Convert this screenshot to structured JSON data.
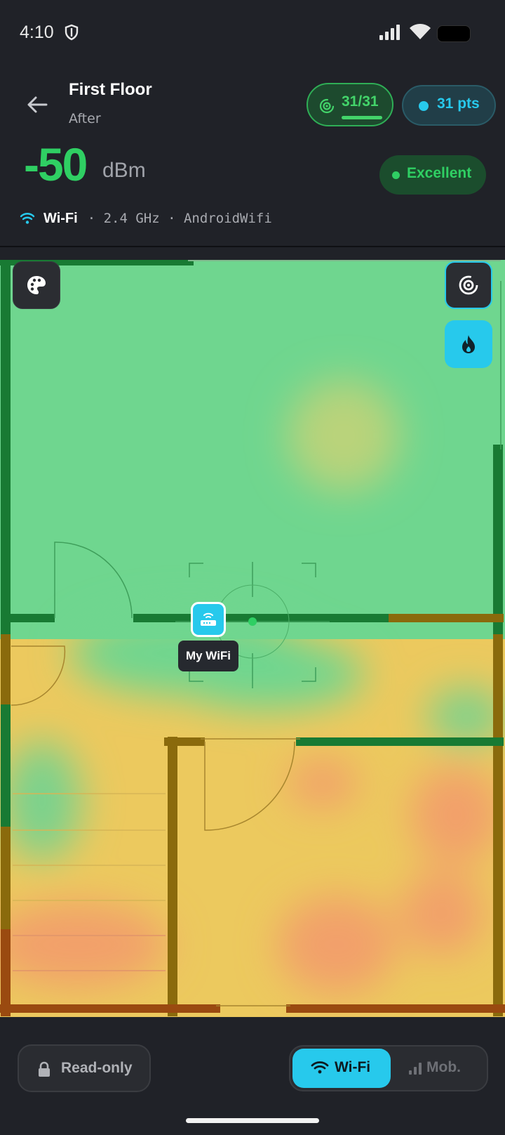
{
  "status_bar": {
    "time": "4:10"
  },
  "header": {
    "title": "First Floor",
    "subtitle": "After",
    "scan_count": "31/31",
    "scan_progress": 1.0,
    "points": "31 pts"
  },
  "signal": {
    "value": "-50",
    "unit": "dBm",
    "quality": "Excellent"
  },
  "network": {
    "type": "Wi-Fi",
    "meta": "· 2.4 GHz · AndroidWifi"
  },
  "map": {
    "router_label": "My WiFi"
  },
  "bottom": {
    "readonly_label": "Read-only",
    "wifi_label": "Wi-Fi",
    "mobile_label": "Mob."
  },
  "colors": {
    "accent": "#27c9ec",
    "excellent": "#2fcf63",
    "heat_good": "#6fd68f",
    "heat_fair": "#ecc95e",
    "heat_weak": "#f2a06a",
    "wall_good": "#187a33",
    "wall_fair": "#8a6a0c",
    "wall_weak": "#9a4a10"
  },
  "icons": [
    "shield-icon",
    "back-arrow-icon",
    "radar-icon",
    "wifi-icon",
    "palette-icon",
    "target-icon",
    "fire-icon",
    "router-icon",
    "lock-icon",
    "cell-signal-icon"
  ]
}
